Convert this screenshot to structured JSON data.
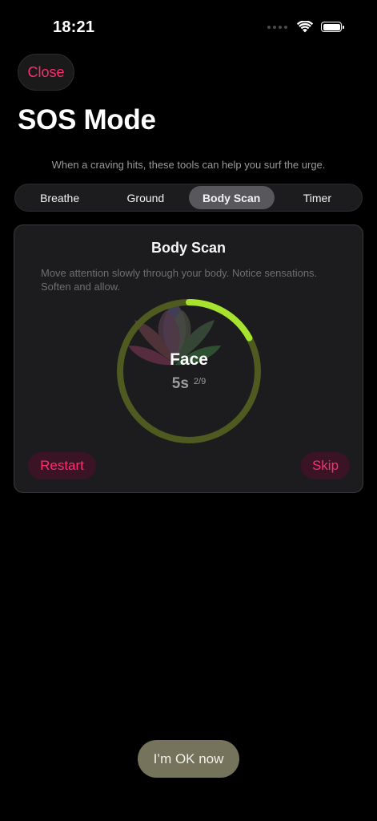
{
  "status_bar": {
    "time": "18:21"
  },
  "header": {
    "close_label": "Close",
    "title": "SOS Mode",
    "subtitle": "When a craving hits, these tools can help you surf the urge."
  },
  "tabs": [
    {
      "label": "Breathe",
      "active": false
    },
    {
      "label": "Ground",
      "active": false
    },
    {
      "label": "Body Scan",
      "active": true
    },
    {
      "label": "Timer",
      "active": false
    }
  ],
  "card": {
    "title": "Body Scan",
    "description": "Move attention slowly through your body. Notice sensations. Soften and allow.",
    "current_area": "Face",
    "seconds": "5s",
    "step": "2/9",
    "ring_progress_fraction": 0.17,
    "restart_label": "Restart",
    "skip_label": "Skip"
  },
  "footer": {
    "ok_label": "I’m OK now"
  },
  "colors": {
    "accent": "#ff2d6f",
    "ring_track": "#4e5a20",
    "ring_progress": "#a6e22e",
    "ok_button": "#76735c"
  }
}
